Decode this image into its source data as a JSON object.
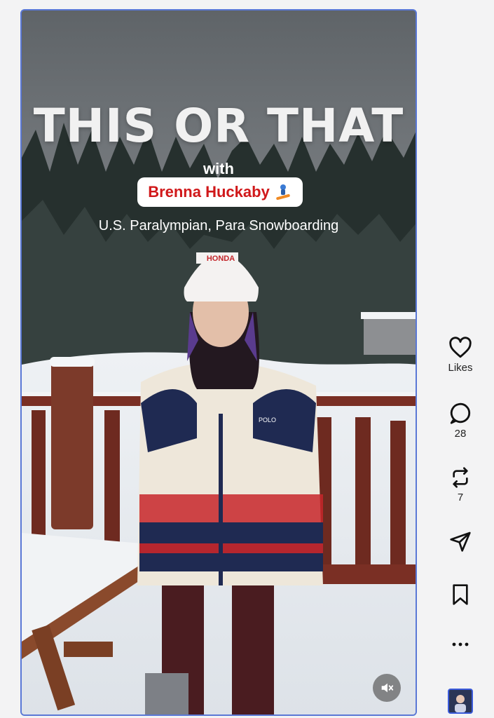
{
  "video": {
    "title_line": "THIS OR THAT",
    "with_line": "with",
    "guest_name": "Brenna Huckaby",
    "guest_emoji_icon": "snowboarder-icon",
    "guest_subtitle": "U.S. Paralympian, Para Snowboarding",
    "beanie_brand": "HONDA",
    "jacket_brand": "POLO",
    "mute_icon": "muted-speaker-icon"
  },
  "actions": {
    "like_label": "Likes",
    "comment_count": "28",
    "repost_count": "7"
  },
  "colors": {
    "pill_text": "#d0181a",
    "frame_border": "#5a78d6"
  }
}
